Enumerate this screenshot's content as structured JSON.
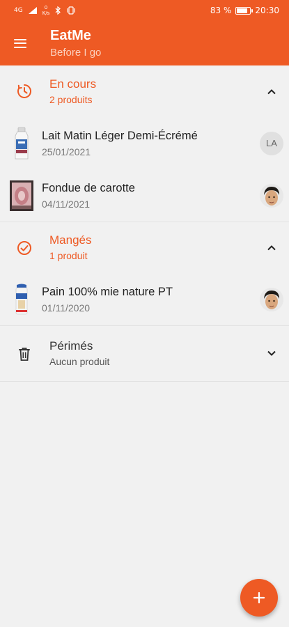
{
  "status_bar": {
    "network": "4G",
    "data_rate_value": "0",
    "data_rate_unit": "K/s",
    "battery": "83 %",
    "battery_level": 0.83,
    "time": "20:30"
  },
  "app_bar": {
    "title": "EatMe",
    "subtitle": "Before I go",
    "menu_icon": "menu-icon"
  },
  "sections": {
    "en_cours": {
      "title": "En cours",
      "subtitle": "2 produits",
      "icon": "clock-icon",
      "expanded": true,
      "items": [
        {
          "name": "Lait Matin Léger Demi-Écrémé",
          "date": "25/01/2021",
          "avatar": "LA"
        },
        {
          "name": "Fondue de carotte",
          "date": "04/11/2021",
          "avatar": "face"
        }
      ]
    },
    "manges": {
      "title": "Mangés",
      "subtitle": "1 produit",
      "icon": "check-circle-icon",
      "expanded": true,
      "items": [
        {
          "name": "Pain 100% mie nature PT",
          "date": "01/11/2020",
          "avatar": "face"
        }
      ]
    },
    "perimes": {
      "title": "Périmés",
      "subtitle": "Aucun produit",
      "icon": "trash-icon",
      "expanded": false
    }
  },
  "fab": {
    "icon": "plus-icon"
  },
  "colors": {
    "accent": "#ee5a24",
    "background": "#f1f1f1",
    "divider": "#e2e2e2"
  }
}
